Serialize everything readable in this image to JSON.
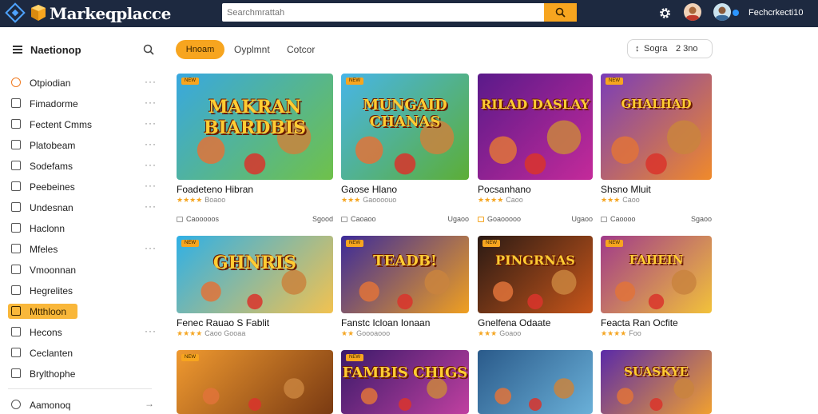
{
  "app": {
    "title": "Markeqplacce"
  },
  "search": {
    "placeholder": "Searchmrattah"
  },
  "user": {
    "name": "Fechcrkecti10"
  },
  "sidebar": {
    "header": "Naetionop",
    "items": [
      {
        "label": "Otpiodian",
        "icon": "circle-badge-icon",
        "dots": true
      },
      {
        "label": "Fimadorme",
        "icon": "edit-icon",
        "dots": true
      },
      {
        "label": "Fectent Cmms",
        "icon": "news-icon",
        "dots": true
      },
      {
        "label": "Platobeam",
        "icon": "square-icon",
        "dots": true
      },
      {
        "label": "Sodefams",
        "icon": "tag-icon",
        "dots": true
      },
      {
        "label": "Peebeines",
        "icon": "filter-icon",
        "dots": true
      },
      {
        "label": "Undesnan",
        "icon": "ring-icon",
        "dots": true
      },
      {
        "label": "Haclonn",
        "icon": "document-icon",
        "dots": false
      },
      {
        "label": "Mfeles",
        "icon": "tag-icon",
        "dots": true
      },
      {
        "label": "Vmoonnan",
        "icon": "box-icon",
        "dots": false
      },
      {
        "label": "Hegrelites",
        "icon": "copy-icon",
        "dots": false
      },
      {
        "label": "Mtthloon",
        "icon": "folder-icon",
        "dots": false,
        "active": true
      },
      {
        "label": "Hecons",
        "icon": "star-icon",
        "dots": true
      },
      {
        "label": "Ceclanten",
        "icon": "play-icon",
        "dots": false
      },
      {
        "label": "Brylthophe",
        "icon": "shield-icon",
        "dots": false
      }
    ],
    "bottom": {
      "label": "Aamonoq",
      "icon": "arrow-right-icon"
    }
  },
  "tabs": [
    "Hnoam",
    "Oyplmnt",
    "Cotcor"
  ],
  "sort": {
    "label": "Sogra",
    "count_label": "2 3no"
  },
  "cards": [
    {
      "badge": "NEW",
      "art_text": "MAKRAN BIARDBIS",
      "title": "Foadeteno Hibran",
      "stars": "★★★★",
      "rating": "Boaoo",
      "meta_left": "Caooooos",
      "meta_right": "Sgood",
      "colors": [
        "#38a8e0",
        "#6fc14a"
      ]
    },
    {
      "badge": "NEW",
      "art_text": "MUNGAID CHANAS",
      "title": "Gaose Hlano",
      "stars": "★★★",
      "rating": "Gaoooouo",
      "meta_left": "Caoaoo",
      "meta_right": "Ugaoo",
      "colors": [
        "#47b5e8",
        "#5cae36"
      ]
    },
    {
      "badge": "",
      "art_text": "RILAD DASLAY",
      "title": "Pocsanhano",
      "stars": "★★★★",
      "rating": "Caoo",
      "meta_left": "Goaooooo",
      "meta_right": "Ugaoo",
      "colors": [
        "#5a1a8a",
        "#c42a9a"
      ]
    },
    {
      "badge": "NEW",
      "art_text": "GHALHAD",
      "title": "Shsno Mluit",
      "stars": "★★★",
      "rating": "Caoo",
      "meta_left": "Caoooo",
      "meta_right": "Sgaoo",
      "colors": [
        "#7a3db8",
        "#f08a2a"
      ]
    },
    {
      "badge": "NEW",
      "art_text": "GHNRIS",
      "title": "Fenec Rauao S Fablit",
      "stars": "★★★★",
      "rating": "Caoo Gooaa",
      "meta_left": "",
      "meta_right": "",
      "colors": [
        "#2fb0e6",
        "#f2c250"
      ]
    },
    {
      "badge": "NEW",
      "art_text": "TEADB!",
      "title": "Fanstc Icloan Ionaan",
      "stars": "★★",
      "rating": "Goooaooo",
      "meta_left": "",
      "meta_right": "",
      "colors": [
        "#3b2a9a",
        "#f0a020"
      ]
    },
    {
      "badge": "NEW",
      "art_text": "PINGRNAS",
      "title": "Gnelfena Odaate",
      "stars": "★★★",
      "rating": "Goaoo",
      "meta_left": "",
      "meta_right": "",
      "colors": [
        "#2a1a14",
        "#c8561a"
      ]
    },
    {
      "badge": "NEW",
      "art_text": "FAHEIN",
      "title": "Feacta Ran Ocfite",
      "stars": "★★★★",
      "rating": "Foo",
      "meta_left": "",
      "meta_right": "",
      "colors": [
        "#a03a8a",
        "#f2c23a"
      ]
    },
    {
      "badge": "NEW",
      "art_text": "",
      "title": "",
      "stars": "",
      "rating": "",
      "meta_left": "",
      "meta_right": "",
      "colors": [
        "#f09a30",
        "#7a3a12"
      ]
    },
    {
      "badge": "NEW",
      "art_text": "FAMBIS CHIGS",
      "title": "",
      "stars": "",
      "rating": "",
      "meta_left": "",
      "meta_right": "",
      "colors": [
        "#3a1a6a",
        "#c040a0"
      ]
    },
    {
      "badge": "",
      "art_text": "",
      "title": "",
      "stars": "",
      "rating": "",
      "meta_left": "",
      "meta_right": "",
      "colors": [
        "#2a5a8a",
        "#6ab0d8"
      ]
    },
    {
      "badge": "",
      "art_text": "SUASKYE",
      "title": "",
      "stars": "",
      "rating": "",
      "meta_left": "",
      "meta_right": "",
      "colors": [
        "#5a2aa8",
        "#f0a030"
      ]
    }
  ]
}
